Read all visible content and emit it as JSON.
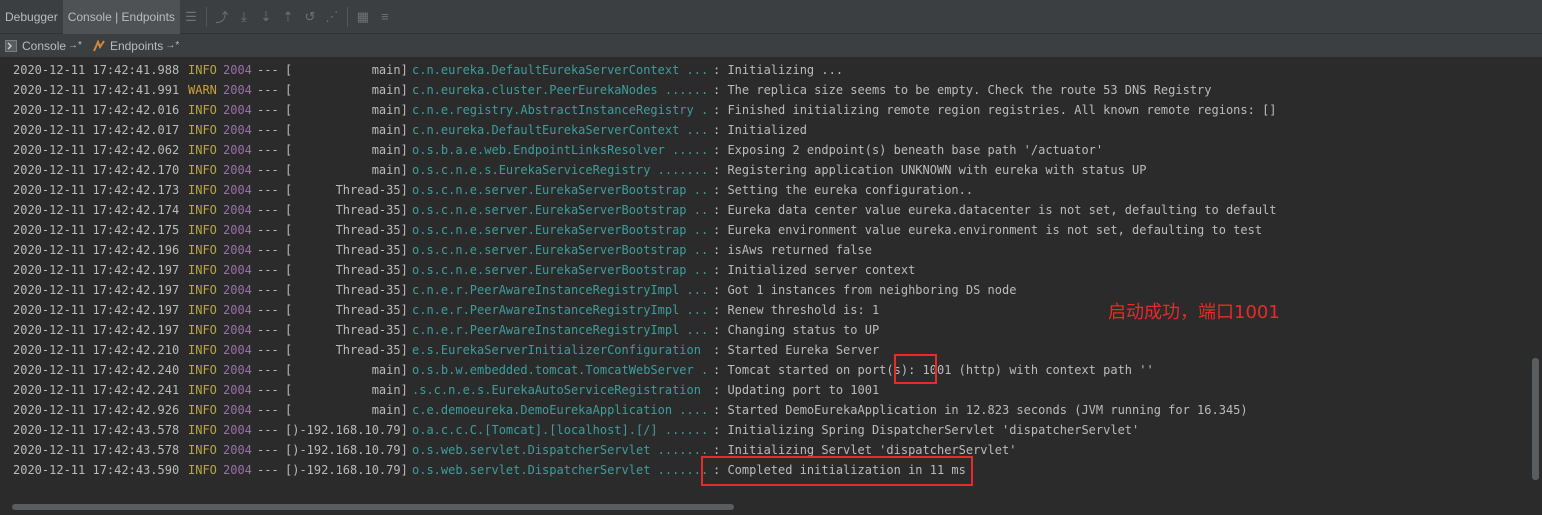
{
  "toolbar": {
    "tabs": [
      {
        "label": "Debugger",
        "active": false
      },
      {
        "label": "Console | Endpoints",
        "active": true
      }
    ],
    "ghost_title": "",
    "icons": [
      "menu-icon",
      "show-execution-point-icon",
      "step-over-icon",
      "step-into-icon",
      "step-out-icon",
      "run-to-cursor-icon",
      "evaluate-expression-icon",
      "table-icon",
      "settings-icon"
    ]
  },
  "subtabs": [
    {
      "label": "Console",
      "pin": "→*",
      "icon": "console-icon"
    },
    {
      "label": "Endpoints",
      "pin": "→*",
      "icon": "endpoints-icon"
    }
  ],
  "log": [
    {
      "ts": "2020-12-11 17:42:41.988",
      "level": "INFO",
      "pid": "2004",
      "sep": "---",
      "thread": "[           main]",
      "logger": "c.n.eureka.DefaultEurekaServerContext",
      "dots": " ....",
      "msg": ": Initializing ..."
    },
    {
      "ts": "2020-12-11 17:42:41.991",
      "level": "WARN",
      "pid": "2004",
      "sep": "---",
      "thread": "[           main]",
      "logger": "c.n.eureka.cluster.PeerEurekaNodes",
      "dots": " .......",
      "msg": ": The replica size seems to be empty. Check the route 53 DNS Registry"
    },
    {
      "ts": "2020-12-11 17:42:42.016",
      "level": "INFO",
      "pid": "2004",
      "sep": "---",
      "thread": "[           main]",
      "logger": "c.n.e.registry.AbstractInstanceRegistry",
      "dots": " ..",
      "msg": ": Finished initializing remote region registries. All known remote regions: []"
    },
    {
      "ts": "2020-12-11 17:42:42.017",
      "level": "INFO",
      "pid": "2004",
      "sep": "---",
      "thread": "[           main]",
      "logger": "c.n.eureka.DefaultEurekaServerContext",
      "dots": " ....",
      "msg": ": Initialized"
    },
    {
      "ts": "2020-12-11 17:42:42.062",
      "level": "INFO",
      "pid": "2004",
      "sep": "---",
      "thread": "[           main]",
      "logger": "o.s.b.a.e.web.EndpointLinksResolver",
      "dots": " ......",
      "msg": ": Exposing 2 endpoint(s) beneath base path '/actuator'"
    },
    {
      "ts": "2020-12-11 17:42:42.170",
      "level": "INFO",
      "pid": "2004",
      "sep": "---",
      "thread": "[           main]",
      "logger": "o.s.c.n.e.s.EurekaServiceRegistry",
      "dots": " .......",
      "msg": ": Registering application UNKNOWN with eureka with status UP"
    },
    {
      "ts": "2020-12-11 17:42:42.173",
      "level": "INFO",
      "pid": "2004",
      "sep": "---",
      "thread": "[      Thread-35]",
      "logger": "o.s.c.n.e.server.EurekaServerBootstrap",
      "dots": " ...",
      "msg": ": Setting the eureka configuration.."
    },
    {
      "ts": "2020-12-11 17:42:42.174",
      "level": "INFO",
      "pid": "2004",
      "sep": "---",
      "thread": "[      Thread-35]",
      "logger": "o.s.c.n.e.server.EurekaServerBootstrap",
      "dots": " ...",
      "msg": ": Eureka data center value eureka.datacenter is not set, defaulting to default"
    },
    {
      "ts": "2020-12-11 17:42:42.175",
      "level": "INFO",
      "pid": "2004",
      "sep": "---",
      "thread": "[      Thread-35]",
      "logger": "o.s.c.n.e.server.EurekaServerBootstrap",
      "dots": " ...",
      "msg": ": Eureka environment value eureka.environment is not set, defaulting to test"
    },
    {
      "ts": "2020-12-11 17:42:42.196",
      "level": "INFO",
      "pid": "2004",
      "sep": "---",
      "thread": "[      Thread-35]",
      "logger": "o.s.c.n.e.server.EurekaServerBootstrap",
      "dots": " ...",
      "msg": ": isAws returned false"
    },
    {
      "ts": "2020-12-11 17:42:42.197",
      "level": "INFO",
      "pid": "2004",
      "sep": "---",
      "thread": "[      Thread-35]",
      "logger": "o.s.c.n.e.server.EurekaServerBootstrap",
      "dots": " ...",
      "msg": ": Initialized server context"
    },
    {
      "ts": "2020-12-11 17:42:42.197",
      "level": "INFO",
      "pid": "2004",
      "sep": "---",
      "thread": "[      Thread-35]",
      "logger": "c.n.e.r.PeerAwareInstanceRegistryImpl",
      "dots": " ....",
      "msg": ": Got 1 instances from neighboring DS node"
    },
    {
      "ts": "2020-12-11 17:42:42.197",
      "level": "INFO",
      "pid": "2004",
      "sep": "---",
      "thread": "[      Thread-35]",
      "logger": "c.n.e.r.PeerAwareInstanceRegistryImpl",
      "dots": " ....",
      "msg": ": Renew threshold is: 1"
    },
    {
      "ts": "2020-12-11 17:42:42.197",
      "level": "INFO",
      "pid": "2004",
      "sep": "---",
      "thread": "[      Thread-35]",
      "logger": "c.n.e.r.PeerAwareInstanceRegistryImpl",
      "dots": " ....",
      "msg": ": Changing status to UP"
    },
    {
      "ts": "2020-12-11 17:42:42.210",
      "level": "INFO",
      "pid": "2004",
      "sep": "---",
      "thread": "[      Thread-35]",
      "logger": "e.s.EurekaServerInitializerConfiguration",
      "dots": " ",
      "msg": ": Started Eureka Server"
    },
    {
      "ts": "2020-12-11 17:42:42.240",
      "level": "INFO",
      "pid": "2004",
      "sep": "---",
      "thread": "[           main]",
      "logger": "o.s.b.w.embedded.tomcat.TomcatWebServer",
      "dots": " ..",
      "msg": ": Tomcat started on port(s): 1001 (http) with context path ''"
    },
    {
      "ts": "2020-12-11 17:42:42.241",
      "level": "INFO",
      "pid": "2004",
      "sep": "---",
      "thread": "[           main]",
      "logger": ".s.c.n.e.s.EurekaAutoServiceRegistration",
      "dots": " ",
      "msg": ": Updating port to 1001"
    },
    {
      "ts": "2020-12-11 17:42:42.926",
      "level": "INFO",
      "pid": "2004",
      "sep": "---",
      "thread": "[           main]",
      "logger": "c.e.demoeureka.DemoEurekaApplication",
      "dots": " .....",
      "msg": ": Started DemoEurekaApplication in 12.823 seconds (JVM running for 16.345)"
    },
    {
      "ts": "2020-12-11 17:42:43.578",
      "level": "INFO",
      "pid": "2004",
      "sep": "---",
      "thread": "[)-192.168.10.79]",
      "logger": "o.a.c.c.C.[Tomcat].[localhost].[/]",
      "dots": " .......",
      "msg": ": Initializing Spring DispatcherServlet 'dispatcherServlet'"
    },
    {
      "ts": "2020-12-11 17:42:43.578",
      "level": "INFO",
      "pid": "2004",
      "sep": "---",
      "thread": "[)-192.168.10.79]",
      "logger": "o.s.web.servlet.DispatcherServlet",
      "dots": " ........",
      "msg": ": Initializing Servlet 'dispatcherServlet'"
    },
    {
      "ts": "2020-12-11 17:42:43.590",
      "level": "INFO",
      "pid": "2004",
      "sep": "---",
      "thread": "[)-192.168.10.79]",
      "logger": "o.s.web.servlet.DispatcherServlet",
      "dots": " ........",
      "msg": ": Completed initialization in 11 ms"
    }
  ],
  "annotation": {
    "text": "启动成功，端口1001",
    "color": "#e82a2a"
  },
  "watermark": "",
  "colors": {
    "background": "#2b2b2b",
    "info": "#b9a64a",
    "pid": "#9a71a6",
    "logger": "#3f9c9c",
    "text": "#bbbbbb"
  }
}
